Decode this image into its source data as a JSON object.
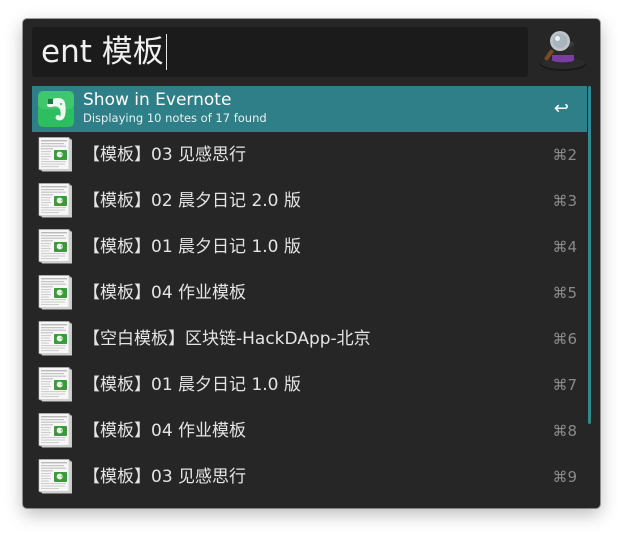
{
  "search": {
    "query": "ent 模板"
  },
  "results": {
    "selected": {
      "title": "Show in Evernote",
      "subtitle": "Displaying 10 notes of 17 found",
      "shortcut": "↩",
      "icon": "evernote-elephant-icon"
    },
    "items": [
      {
        "title": "【模板】03 见感思行",
        "shortcut": "⌘2",
        "icon": "note-document-icon"
      },
      {
        "title": "【模板】02 晨夕日记 2.0 版",
        "shortcut": "⌘3",
        "icon": "note-document-icon"
      },
      {
        "title": "【模板】01 晨夕日记 1.0 版",
        "shortcut": "⌘4",
        "icon": "note-document-icon"
      },
      {
        "title": "【模板】04 作业模板",
        "shortcut": "⌘5",
        "icon": "note-document-icon"
      },
      {
        "title": "【空白模板】区块链-HackDApp-北京",
        "shortcut": "⌘6",
        "icon": "note-document-icon"
      },
      {
        "title": "【模板】01 晨夕日记 1.0 版",
        "shortcut": "⌘7",
        "icon": "note-document-icon"
      },
      {
        "title": "【模板】04 作业模板",
        "shortcut": "⌘8",
        "icon": "note-document-icon"
      },
      {
        "title": "【模板】03 见感思行",
        "shortcut": "⌘9",
        "icon": "note-document-icon"
      }
    ]
  },
  "colors": {
    "window_bg": "#262626",
    "search_bg": "#1b1b1b",
    "selected_bg": "#2e7f88",
    "scrollbar": "#2f8892",
    "evernote_green": "#2dbe60"
  },
  "logo": {
    "icon": "alfred-hat-icon"
  }
}
